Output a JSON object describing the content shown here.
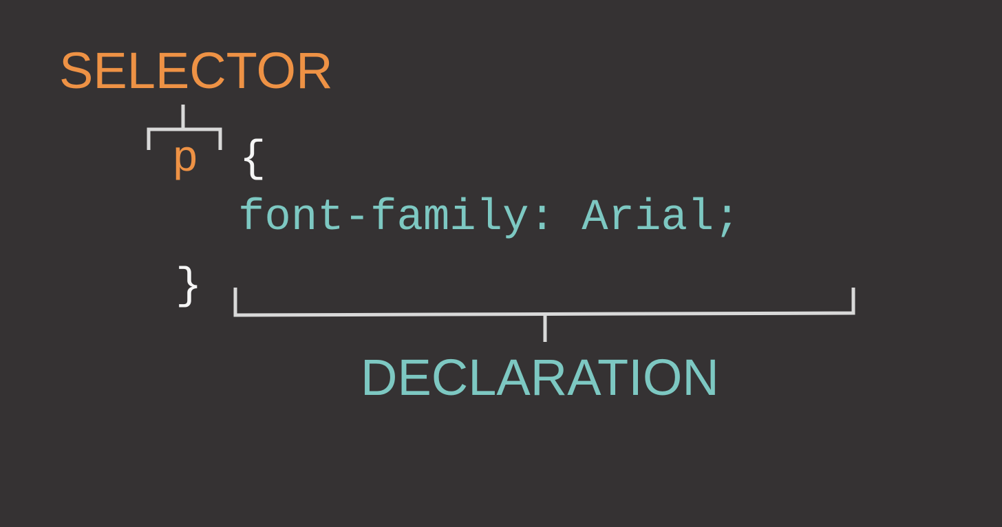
{
  "labels": {
    "selector": "SELECTOR",
    "declaration": "DECLARATION"
  },
  "code": {
    "selector": "p",
    "open_brace": "{",
    "declaration": "font-family: Arial;",
    "close_brace": "}"
  },
  "colors": {
    "background": "#353233",
    "selector": "#ee9245",
    "declaration": "#7dc8c2",
    "brace": "#f5f5f5",
    "bracket_line": "#d9d9d9"
  }
}
